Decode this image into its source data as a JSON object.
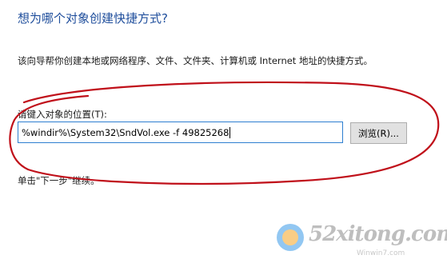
{
  "wizard": {
    "heading": "想为哪个对象创建快捷方式?",
    "description": "该向导帮你创建本地或网络程序、文件、文件夹、计算机或 Internet 地址的快捷方式。",
    "location_label": "请键入对象的位置(T):",
    "location_value": "%windir%\\System32\\SndVol.exe -f 49825268",
    "browse_label": "浏览(R)...",
    "hint": "单击\"下一步\"继续。"
  },
  "annotation": {
    "color": "#c0101a"
  },
  "watermark": {
    "brand": "52xitong.com",
    "sub": "Winwin7.com"
  }
}
